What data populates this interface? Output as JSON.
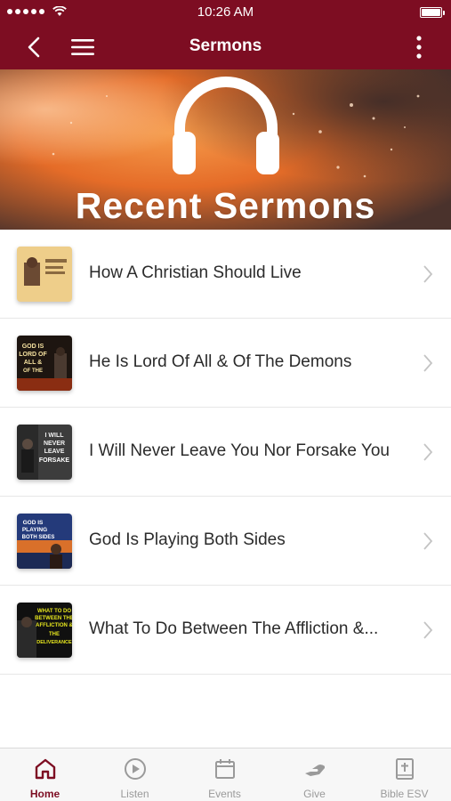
{
  "status_bar": {
    "time": "10:26 AM"
  },
  "nav": {
    "title": "Sermons"
  },
  "banner": {
    "text": "Recent Sermons"
  },
  "sermons": [
    {
      "title": "How A Christian Should Live",
      "thumb_text": ""
    },
    {
      "title": "He Is Lord Of All & Of The Demons",
      "thumb_text": "GOD IS LORD OF ALL & OF THE DEMONS"
    },
    {
      "title": "I Will Never Leave You Nor Forsake You",
      "thumb_text": "I WILL NEVER LEAVE YOU NOR FORSAKE YOU"
    },
    {
      "title": "God Is Playing Both Sides",
      "thumb_text": "GOD IS PLAYING BOTH SIDES"
    },
    {
      "title": "What To Do Between The Affliction &...",
      "thumb_text": "WHAT TO DO BETWEEN THE AFFLICTION & THE DELIVERANCE"
    }
  ],
  "tabs": [
    {
      "label": "Home",
      "icon": "home-icon",
      "active": true
    },
    {
      "label": "Listen",
      "icon": "play-circle-icon",
      "active": false
    },
    {
      "label": "Events",
      "icon": "calendar-icon",
      "active": false
    },
    {
      "label": "Give",
      "icon": "giving-hand-icon",
      "active": false
    },
    {
      "label": "Bible ESV",
      "icon": "bible-icon",
      "active": false
    }
  ],
  "colors": {
    "brand": "#7d0d22",
    "tab_inactive": "#9a9a9a",
    "text": "#2b2b2b"
  }
}
